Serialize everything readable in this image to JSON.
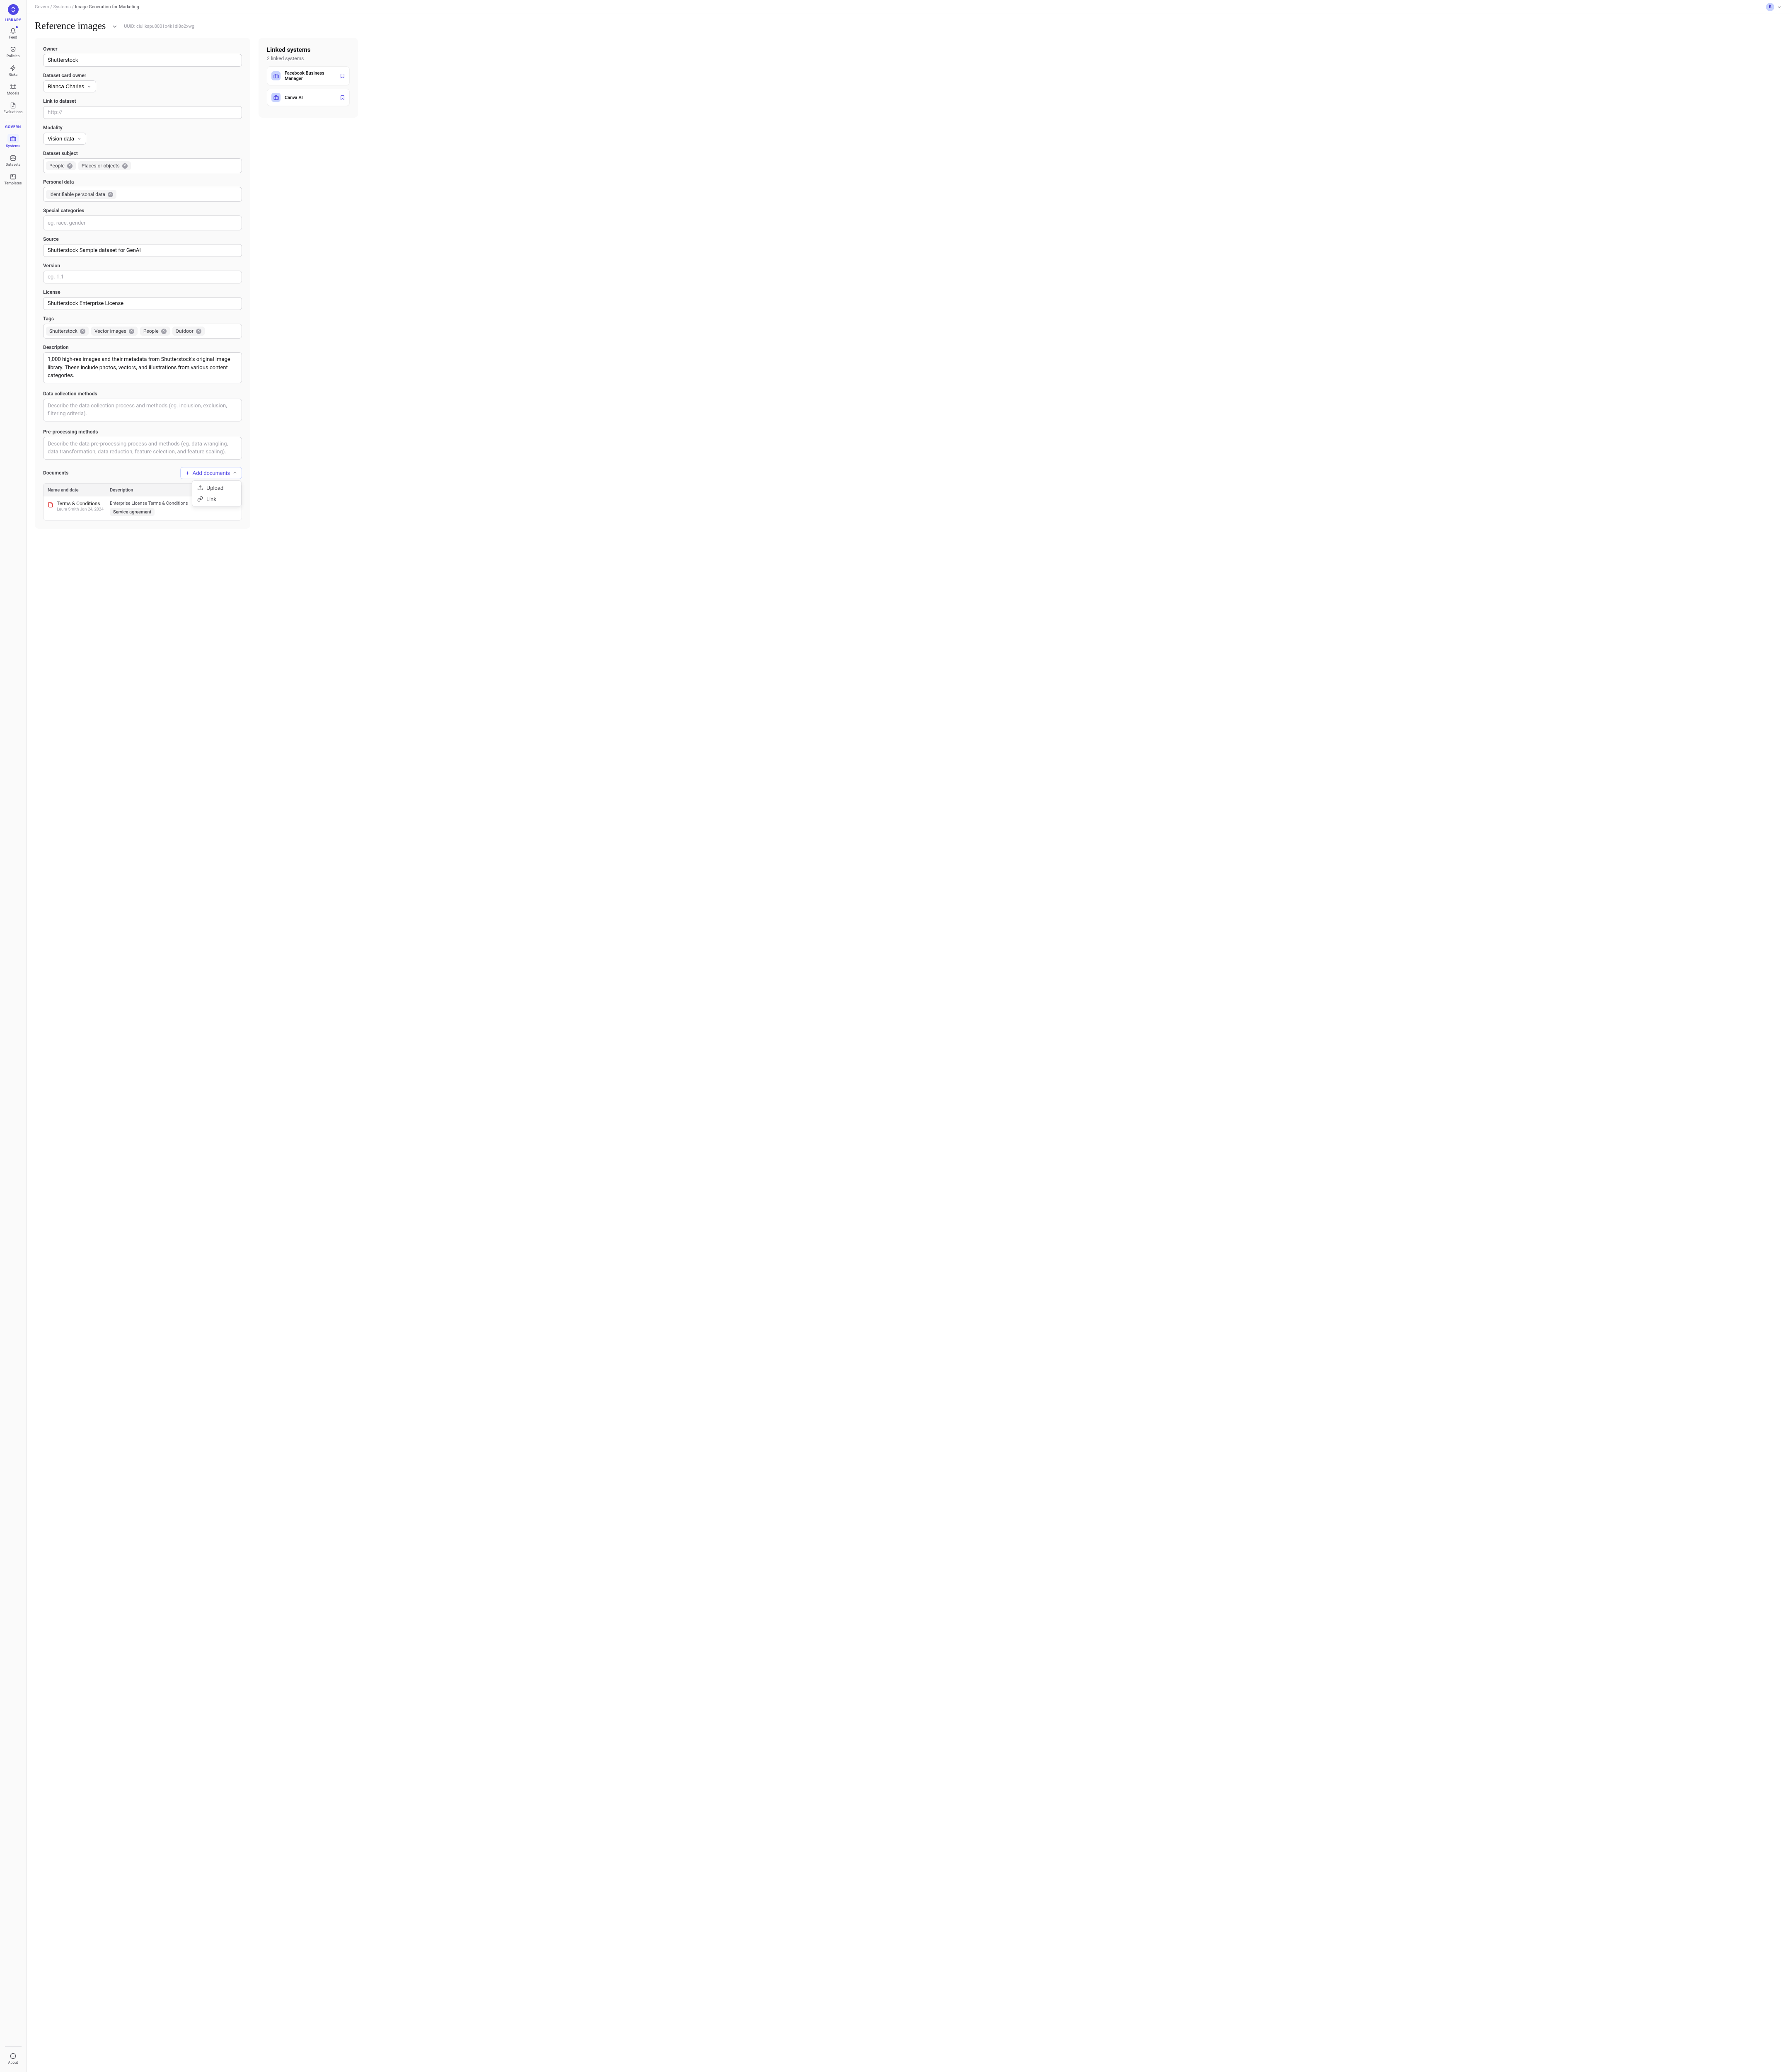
{
  "sidebar": {
    "section_library": "LIBRARY",
    "section_govern": "GOVERN",
    "items": {
      "feed": "Feed",
      "policies": "Policies",
      "risks": "Risks",
      "models": "Models",
      "evaluations": "Evaluations",
      "systems": "Systems",
      "datasets": "Datasets",
      "templates": "Templates",
      "about": "About"
    }
  },
  "topbar": {
    "crumb1": "Govern",
    "crumb2": "Systems",
    "crumb3": "Image Generation for Marketing",
    "sep": " / ",
    "user_initial": "K"
  },
  "header": {
    "title": "Reference images",
    "uuid_label": "UUID: ",
    "uuid": "cluilkapu0001o4k1dl8o2xwg"
  },
  "form": {
    "owner_label": "Owner",
    "owner_value": "Shutterstock",
    "card_owner_label": "Dataset card owner",
    "card_owner_value": "Bianca Charles",
    "link_label": "Link to dataset",
    "link_placeholder": "http://",
    "modality_label": "Modality",
    "modality_value": "Vision data",
    "subject_label": "Dataset subject",
    "subject_tags": [
      "People",
      "Places or objects"
    ],
    "personal_label": "Personal data",
    "personal_tags": [
      "Identifiable personal data"
    ],
    "special_label": "Special categories",
    "special_placeholder": "eg. race, gender",
    "source_label": "Source",
    "source_value": "Shutterstock Sample dataset for GenAI",
    "version_label": "Version",
    "version_placeholder": "eg. 1.1",
    "license_label": "License",
    "license_value": "Shutterstock Enterprise License",
    "tags_label": "Tags",
    "tags": [
      "Shutterstock",
      "Vector images",
      "People",
      "Outdoor"
    ],
    "description_label": "Description",
    "description_value": "1,000 high-res images and their metadata from Shutterstock's original image library. These include photos, vectors, and illustrations from various content categories.",
    "collection_label": "Data collection methods",
    "collection_placeholder": "Describe the data collection process and methods (eg. inclusion, exclusion, filtering criteria).",
    "preprocess_label": "Pre-processing methods",
    "preprocess_placeholder": "Describe the data pre-processing process and methods (eg. data wrangling, data transformation, data reduction, feature selection, and feature scaling)."
  },
  "documents": {
    "heading": "Documents",
    "add_btn": "Add documents",
    "dropdown": {
      "upload": "Upload",
      "link": "Link"
    },
    "columns": {
      "name": "Name and date",
      "desc": "Description"
    },
    "row": {
      "name": "Terms & Conditions",
      "author": "Laura Smith",
      "date": "Jan 24, 2024",
      "desc": "Enterprise License Terms & Conditions",
      "badge": "Service agreement"
    }
  },
  "linked": {
    "title": "Linked systems",
    "subtitle": "2 linked systems",
    "items": [
      "Facebook Business Manager",
      "Canva AI"
    ]
  }
}
